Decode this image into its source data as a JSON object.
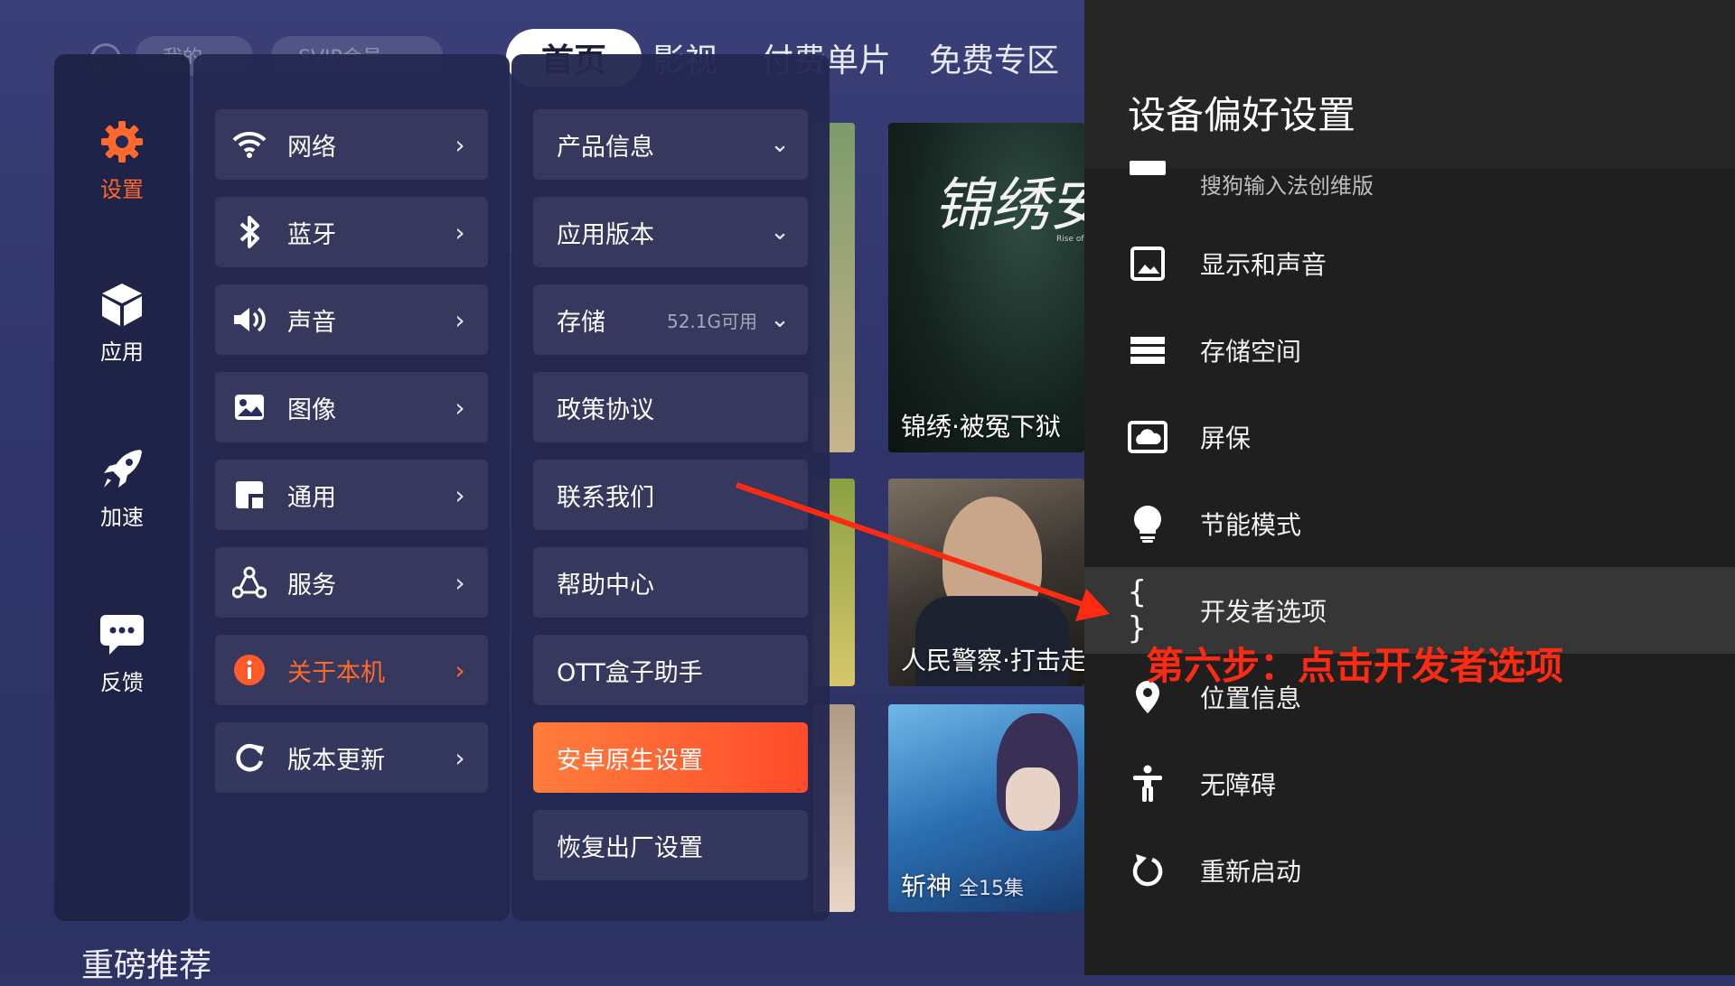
{
  "topbar": {
    "search_text": "我的",
    "vip_text": "SVIP会员",
    "tabs": [
      {
        "label": "首页"
      },
      {
        "label": "影视"
      },
      {
        "label": "付费单片"
      },
      {
        "label": "免费专区"
      }
    ]
  },
  "posters": [
    {
      "caption": "锦绣·被冤下狱",
      "logo_text": "锦绣安宁",
      "sub": "Rise of Ning"
    },
    {
      "caption": "人民警察·打击走"
    },
    {
      "caption": "斩神",
      "episodes": "全15集"
    }
  ],
  "section_title": "重磅推荐",
  "categories": [
    {
      "label": "设置",
      "icon": "gear-icon"
    },
    {
      "label": "应用",
      "icon": "cube-icon"
    },
    {
      "label": "加速",
      "icon": "rocket-icon"
    },
    {
      "label": "反馈",
      "icon": "chat-icon"
    }
  ],
  "menu": [
    {
      "label": "网络",
      "icon": "wifi-icon"
    },
    {
      "label": "蓝牙",
      "icon": "bluetooth-icon"
    },
    {
      "label": "声音",
      "icon": "speaker-icon"
    },
    {
      "label": "图像",
      "icon": "image-icon"
    },
    {
      "label": "通用",
      "icon": "general-icon"
    },
    {
      "label": "服务",
      "icon": "service-icon"
    },
    {
      "label": "关于本机",
      "icon": "info-icon"
    },
    {
      "label": "版本更新",
      "icon": "refresh-icon"
    }
  ],
  "sub_menu": [
    {
      "label": "产品信息",
      "extra": ""
    },
    {
      "label": "应用版本",
      "extra": ""
    },
    {
      "label": "存储",
      "extra": "52.1G可用"
    },
    {
      "label": "政策协议",
      "extra": ""
    },
    {
      "label": "联系我们",
      "extra": ""
    },
    {
      "label": "帮助中心",
      "extra": ""
    },
    {
      "label": "OTT盒子助手",
      "extra": ""
    },
    {
      "label": "安卓原生设置",
      "extra": ""
    },
    {
      "label": "恢复出厂设置",
      "extra": ""
    }
  ],
  "panel": {
    "title": "设备偏好设置",
    "partial_item": "搜狗输入法创维版",
    "items": [
      {
        "label": "显示和声音",
        "icon": "display-icon"
      },
      {
        "label": "存储空间",
        "icon": "storage-icon"
      },
      {
        "label": "屏保",
        "icon": "screensaver-icon"
      },
      {
        "label": "节能模式",
        "icon": "bulb-icon"
      },
      {
        "label": "开发者选项",
        "icon": "braces-icon"
      },
      {
        "label": "位置信息",
        "icon": "location-icon"
      },
      {
        "label": "无障碍",
        "icon": "accessibility-icon"
      },
      {
        "label": "重新启动",
        "icon": "restart-icon"
      }
    ]
  },
  "annotation": "第六步：点击开发者选项",
  "colors": {
    "accent": "#ff6a2c",
    "annotation": "#ff2a12",
    "panel_bg": "#1f1f1f"
  }
}
